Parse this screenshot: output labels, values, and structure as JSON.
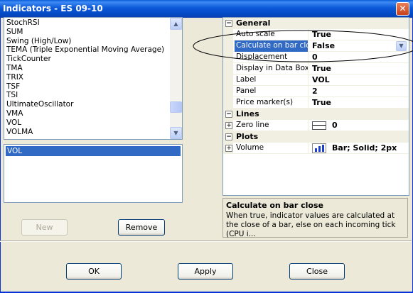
{
  "window": {
    "title": "Indicators - ES 09-10",
    "close_glyph": "✕"
  },
  "indicator_list": {
    "items": [
      "StochRSI",
      "SUM",
      "Swing (High/Low)",
      "TEMA (Triple Exponential Moving Average)",
      "TickCounter",
      "TMA",
      "TRIX",
      "TSF",
      "TSI",
      "UltimateOscillator",
      "VMA",
      "VOL",
      "VOLMA"
    ],
    "scroll_up_icon": "▲",
    "scroll_down_icon": "▼"
  },
  "selected_list": {
    "items": [
      "VOL"
    ]
  },
  "buttons": {
    "new": "New",
    "remove": "Remove",
    "ok": "OK",
    "apply": "Apply",
    "close": "Close"
  },
  "properties": {
    "categories": {
      "general": "General",
      "lines": "Lines",
      "plots": "Plots"
    },
    "general_rows": [
      {
        "name": "Auto scale",
        "value": "True"
      },
      {
        "name": "Calculate on bar close",
        "value": "False"
      },
      {
        "name": "Displacement",
        "value": "0"
      },
      {
        "name": "Display in Data Box",
        "value": "True"
      },
      {
        "name": "Label",
        "value": "VOL"
      },
      {
        "name": "Panel",
        "value": "2"
      },
      {
        "name": "Price marker(s)",
        "value": "True"
      }
    ],
    "lines_rows": [
      {
        "name": "Zero line",
        "value": "0"
      }
    ],
    "plots_rows": [
      {
        "name": "Volume",
        "value": "Bar; Solid; 2px"
      }
    ],
    "expand_glyph": "+",
    "collapse_glyph": "−",
    "dropdown_icon": "▼"
  },
  "description": {
    "title": "Calculate on bar close",
    "text": "When true, indicator values are calculated at the close of a bar, else on each incoming tick (CPU i..."
  },
  "colors": {
    "accent": "#316ac5",
    "title_bar": "#0b58d8",
    "bar_plot": "#1c3fd0",
    "annotation_ellipse": "#000000"
  }
}
